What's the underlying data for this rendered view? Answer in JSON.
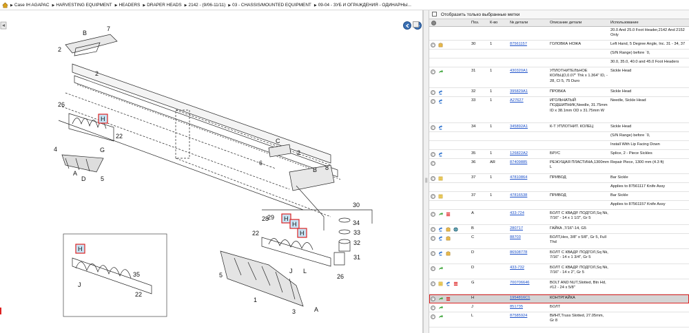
{
  "breadcrumb": [
    "Case IH AGAPAC",
    "HARVESTING EQUIPMENT",
    "HEADERS",
    "DRAPER HEADS",
    "2142 - (9/06-11/11)",
    "03 - CHASSIS/MOUNTED EQUIPMENT",
    "09-04 - ЗУБ И ОГРАЖДЕНИЯ - ОДИНАРНЫ..."
  ],
  "filter": {
    "label": "Отобразить только выбранные метки"
  },
  "table": {
    "headers": {
      "pos": "Поз.",
      "qty": "К-во",
      "part": "№ детали",
      "desc": "Описание детали",
      "use": "Использование"
    },
    "rows": [
      {
        "icons": [],
        "pos": "",
        "qty": "",
        "part": "",
        "desc": "",
        "use": "20.0 And 25.0 Foot Header,2142 And 2152 Only",
        "h": 20
      },
      {
        "icons": [
          "circle",
          "box"
        ],
        "pos": "30",
        "qty": "1",
        "part": "87561157",
        "desc": "ГОЛОВКА НОЖА",
        "use": "Left Hand, 5 Degree Angle, Inc. 31 - 34, 37",
        "h": 13
      },
      {
        "icons": [],
        "pos": "",
        "qty": "",
        "part": "",
        "desc": "",
        "use": "(S/N Range) before `0,",
        "h": 13
      },
      {
        "icons": [],
        "pos": "",
        "qty": "",
        "part": "",
        "desc": "",
        "use": "30.0, 35.0, 40.0 and 45.0 Foot Headers",
        "h": 13
      },
      {
        "icons": [
          "circle",
          "arrow"
        ],
        "pos": "31",
        "qty": "1",
        "part": "430320A1",
        "desc": "УПЛОТНИТЕЛЬНОЕ КОЛЬЦО,0.07\" Thk x 1.364\" ID, - 28, CI 5, 75 Duro",
        "use": "Sickle Head",
        "h": 30
      },
      {
        "icons": [
          "circle",
          "curve"
        ],
        "pos": "32",
        "qty": "1",
        "part": "395829A1",
        "desc": "ПРОБКА",
        "use": "Sickle Head",
        "h": 13
      },
      {
        "icons": [
          "circle",
          "curve"
        ],
        "pos": "33",
        "qty": "1",
        "part": "A27627",
        "desc": "ИГОЛЬЧАТЫЙ ПОДШИПНИК,Needle, 31.75mm ID x 38.1mm OD x 31.75mm W",
        "use": "Needle, Sickle Head",
        "h": 38
      },
      {
        "icons": [
          "circle",
          "curve"
        ],
        "pos": "34",
        "qty": "1",
        "part": "345892A1",
        "desc": "К-Т УПЛОТНИТ. КОЛЕЦ",
        "use": "Sickle Head",
        "h": 13
      },
      {
        "icons": [],
        "pos": "",
        "qty": "",
        "part": "",
        "desc": "",
        "use": "(S/N Range) before `0,",
        "h": 13
      },
      {
        "icons": [],
        "pos": "",
        "qty": "",
        "part": "",
        "desc": "",
        "use": "Install With Lip Facing Down",
        "h": 13
      },
      {
        "icons": [
          "circle",
          "curve"
        ],
        "pos": "35",
        "qty": "1",
        "part": "126822A2",
        "desc": "БРУС",
        "use": "Splice, 2 - Piece Sickles",
        "h": 13
      },
      {
        "icons": [
          "circle"
        ],
        "pos": "36",
        "qty": "AR",
        "part": "87409885",
        "desc": "РЕЖУЩАЯ ПЛАСТИНА,1300mm L",
        "use": "Repair Piece, 1300 mm (4.3 ft)",
        "h": 22
      },
      {
        "icons": [
          "circle",
          "note"
        ],
        "pos": "37",
        "qty": "1",
        "part": "47810864",
        "desc": "ПРИВОД",
        "use": "Bar Sickle",
        "h": 13
      },
      {
        "icons": [],
        "pos": "",
        "qty": "",
        "part": "",
        "desc": "",
        "use": "Applies to 87561117 Knife Assy",
        "h": 13
      },
      {
        "icons": [
          "circle",
          "note"
        ],
        "pos": "37",
        "qty": "1",
        "part": "47816538",
        "desc": "ПРИВОД",
        "use": "Bar Sickle",
        "h": 13
      },
      {
        "icons": [],
        "pos": "",
        "qty": "",
        "part": "",
        "desc": "",
        "use": "Applies to 87561157 Knife Assy",
        "h": 13
      },
      {
        "icons": [
          "circle",
          "arrow",
          "flag"
        ],
        "pos": "A",
        "qty": "",
        "part": "433-724",
        "desc": "БОЛТ С КВАДР. ПОДГОЛ,Sq Nk, 7/16\" - 14 x 1 1/2\", Gr 5",
        "use": "",
        "h": 22
      },
      {
        "icons": [
          "circle",
          "curve",
          "box",
          "globe"
        ],
        "pos": "B",
        "qty": "",
        "part": "280717",
        "desc": "ГАЙКА ,7/16\"-14, G5",
        "use": "",
        "h": 13
      },
      {
        "icons": [
          "circle",
          "curve",
          "box"
        ],
        "pos": "C",
        "qty": "",
        "part": "88703",
        "desc": "БОЛТ,Hex, 3/8\" x 5/8\", Gr 5, Full Thd",
        "use": "",
        "h": 22
      },
      {
        "icons": [
          "circle",
          "curve",
          "box"
        ],
        "pos": "D",
        "qty": "",
        "part": "86508778",
        "desc": "БОЛТ С КВАДР. ПОДГОЛ,Sq Nk, 7/16\" - 14 x 1 3/4\", Gr 5",
        "use": "",
        "h": 22
      },
      {
        "icons": [
          "circle",
          "arrow"
        ],
        "pos": "D",
        "qty": "",
        "part": "433-732",
        "desc": "БОЛТ С КВАДР. ПОДГОЛ,Sq Nk, 7/16\" - 14 x 2\", Gr 5",
        "use": "",
        "h": 22
      },
      {
        "icons": [
          "circle",
          "note",
          "curve",
          "flag"
        ],
        "pos": "G",
        "qty": "",
        "part": "700706646",
        "desc": "BOLT AND NUT,Slotted, Btn Hd, #12 - 24 x 5/8\"",
        "use": "",
        "h": 22
      },
      {
        "icons": [
          "circle",
          "arrow",
          "flag"
        ],
        "pos": "H",
        "qty": "",
        "part": "1954816C1",
        "desc": "КОНТРГАЙКА",
        "use": "",
        "h": 13,
        "selected": true
      },
      {
        "icons": [
          "circle",
          "arrow"
        ],
        "pos": "J",
        "qty": "",
        "part": "851735",
        "desc": "БОЛТ",
        "use": "",
        "h": 13
      },
      {
        "icons": [
          "circle",
          "arrow"
        ],
        "pos": "L",
        "qty": "",
        "part": "87585924",
        "desc": "ВИНТ,Truss Slotted, 27.05mm, Gr 8",
        "use": "",
        "h": 22
      }
    ]
  },
  "diagram_labels": [
    "B",
    "7",
    "2",
    "2",
    "26",
    "H",
    "22",
    "4",
    "G",
    "A",
    "D",
    "5",
    "C",
    "2",
    "6",
    "B",
    "8",
    "30",
    "34",
    "33",
    "32",
    "31",
    "29",
    "H",
    "H",
    "28",
    "H",
    "22",
    "5",
    "26",
    "J",
    "L",
    "1",
    "3",
    "A",
    "H",
    "35",
    "J",
    "22"
  ]
}
